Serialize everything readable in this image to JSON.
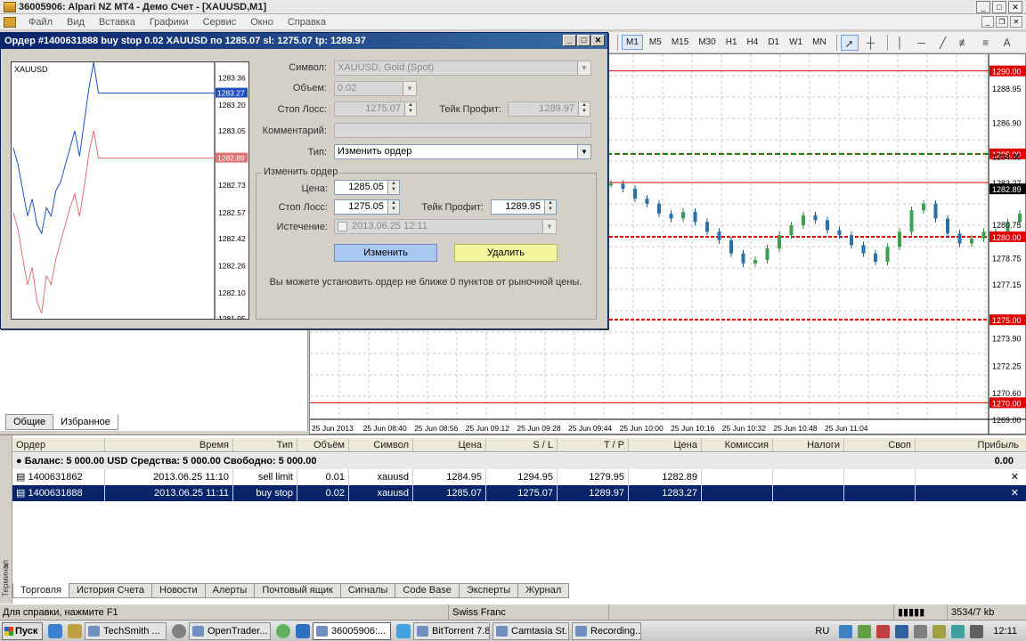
{
  "window": {
    "title": "36005906: Alpari NZ MT4 - Демо Счет - [XAUUSD,M1]"
  },
  "menu": [
    "Файл",
    "Вид",
    "Вставка",
    "Графики",
    "Сервис",
    "Окно",
    "Справка"
  ],
  "toolbar": {
    "timeframes": [
      "M1",
      "M5",
      "M15",
      "M30",
      "H1",
      "H4",
      "D1",
      "W1",
      "MN"
    ],
    "active_timeframe": "M1"
  },
  "dialog": {
    "title": "Ордер #1400631888 buy stop 0.02 XAUUSD по 1285.07 sl: 1275.07 tp: 1289.97",
    "symbol_label": "Символ:",
    "symbol_value": "XAUUSD, Gold (Spot)",
    "volume_label": "Объем:",
    "volume_value": "0.02",
    "sl_label": "Стоп Лосс:",
    "sl_value": "1275.07",
    "tp_label": "Тейк Профит:",
    "tp_value": "1289.97",
    "comment_label": "Комментарий:",
    "type_label": "Тип:",
    "type_value": "Изменить ордер",
    "group_label": "Изменить ордер",
    "price_label": "Цена:",
    "price_value": "1285.05",
    "new_sl_label": "Стоп Лосс:",
    "new_sl_value": "1275.05",
    "new_tp_label": "Тейк Профит:",
    "new_tp_value": "1289.95",
    "expiry_label": "Истечение:",
    "expiry_value": "2013.06.25 12:11",
    "modify_button": "Изменить",
    "delete_button": "Удалить",
    "hint": "Вы можете установить ордер не ближе 0 пунктов от рыночной цены.",
    "mini_chart": {
      "symbol": "XAUUSD",
      "ticks": [
        "1283.36",
        "1283.20",
        "1283.05",
        "1282.89",
        "1282.73",
        "1282.57",
        "1282.42",
        "1282.26",
        "1282.10",
        "1281.95"
      ],
      "ask_label": "1283.27",
      "bid_label": "1282.89",
      "ylim": [
        1281.95,
        1283.45
      ],
      "ask": [
        1282.95,
        1282.85,
        1282.7,
        1282.55,
        1282.65,
        1282.5,
        1282.45,
        1282.6,
        1282.55,
        1282.7,
        1282.75,
        1282.85,
        1282.95,
        1283.05,
        1282.9,
        1283.1,
        1283.3,
        1283.45,
        1283.27,
        1283.27
      ],
      "bid": [
        1282.57,
        1282.47,
        1282.3,
        1282.15,
        1282.25,
        1282.05,
        1281.98,
        1282.2,
        1282.15,
        1282.3,
        1282.4,
        1282.5,
        1282.6,
        1282.68,
        1282.55,
        1282.72,
        1282.92,
        1283.05,
        1282.89,
        1282.89
      ]
    }
  },
  "navigator": {
    "tabs": [
      "Общие",
      "Избранное"
    ],
    "active": "Избранное"
  },
  "chart": {
    "price_labels": [
      "1290.00",
      "1288.95",
      "1286.90",
      "1285.00",
      "1284.85",
      "1283.27",
      "1282.89",
      "1280.75",
      "1280.00",
      "1278.75",
      "1277.15",
      "1275.00",
      "1273.90",
      "1272.25",
      "1270.60",
      "1270.00",
      "1269.00"
    ],
    "time_labels": [
      "25 Jun 2013",
      "25 Jun 08:40",
      "25 Jun 08:56",
      "25 Jun 09:12",
      "25 Jun 09:28",
      "25 Jun 09:44",
      "25 Jun 10:00",
      "25 Jun 10:16",
      "25 Jun 10:32",
      "25 Jun 10:48",
      "25 Jun 11:04"
    ],
    "levels": {
      "tp": 1290.0,
      "entry": 1285.0,
      "current": 1282.89,
      "ask": 1283.27,
      "sl_pending": 1280.0,
      "sl": 1275.0,
      "low": 1270.0
    },
    "ylim": [
      1269.0,
      1291.0
    ]
  },
  "terminal": {
    "side_label": "Терминал",
    "columns": [
      "Ордер",
      "Время",
      "Тип",
      "Объём",
      "Символ",
      "Цена",
      "S / L",
      "T / P",
      "Цена",
      "Комиссия",
      "Налоги",
      "Своп",
      "Прибыль"
    ],
    "balance": "Баланс: 5 000.00 USD  Средства: 5 000.00  Свободно: 5 000.00",
    "balance_profit": "0.00",
    "rows": [
      {
        "order": "1400631862",
        "time": "2013.06.25 11:10",
        "type": "sell limit",
        "volume": "0.01",
        "symbol": "xauusd",
        "price": "1284.95",
        "sl": "1294.95",
        "tp": "1279.95",
        "cur": "1282.89"
      },
      {
        "order": "1400631888",
        "time": "2013.06.25 11:11",
        "type": "buy stop",
        "volume": "0.02",
        "symbol": "xauusd",
        "price": "1285.07",
        "sl": "1275.07",
        "tp": "1289.97",
        "cur": "1283.27"
      }
    ],
    "tabs": [
      "Торговля",
      "История Счета",
      "Новости",
      "Алерты",
      "Почтовый ящик",
      "Сигналы",
      "Code Base",
      "Эксперты",
      "Журнал"
    ],
    "active_tab": "Торговля"
  },
  "status": {
    "help": "Для справки, нажмите F1",
    "profile": "Swiss Franc",
    "traffic": "3534/7 kb"
  },
  "taskbar": {
    "start": "Пуск",
    "tasks": [
      "TechSmith ...",
      "OpenTrader...",
      "36005906:...",
      "BitTorrent 7.8",
      "Camtasia St...",
      "Recording..."
    ],
    "active_task": "36005906:...",
    "lang": "RU",
    "clock": "12:11"
  }
}
